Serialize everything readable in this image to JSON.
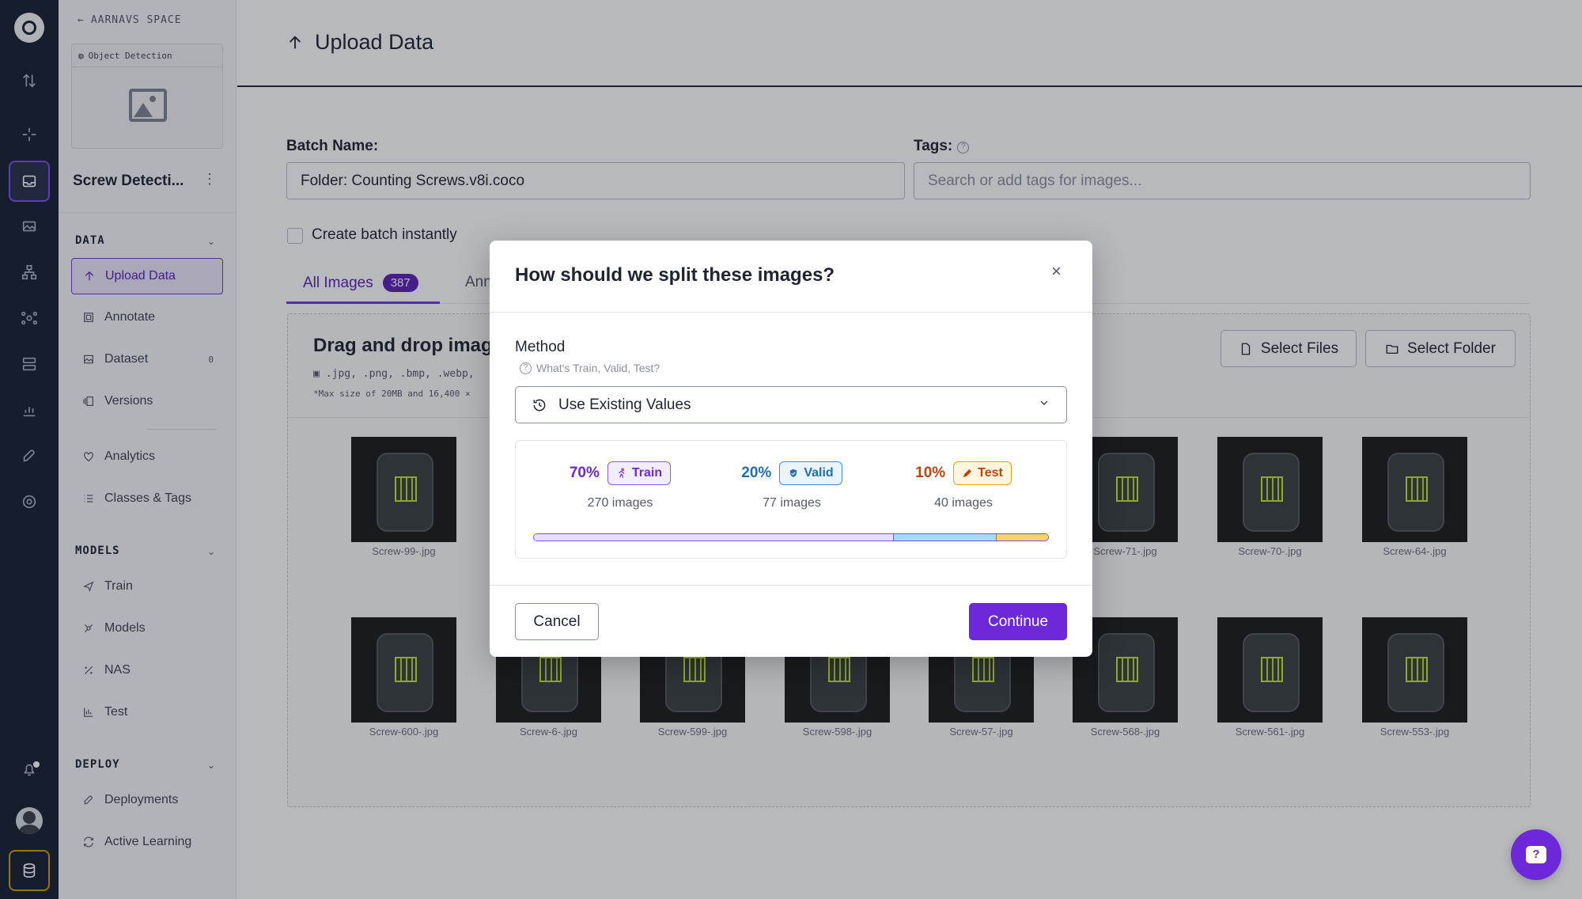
{
  "sidebar": {
    "back_label": "AARNAVS SPACE",
    "project_type": "Object Detection",
    "project_name": "Screw Detecti...",
    "sections": {
      "data": "DATA",
      "models": "MODELS",
      "deploy": "DEPLOY"
    },
    "data_items": [
      {
        "label": "Upload Data",
        "icon": "arrow-up-icon"
      },
      {
        "label": "Annotate",
        "icon": "annotate-icon"
      },
      {
        "label": "Dataset",
        "icon": "image-icon",
        "count": "0"
      },
      {
        "label": "Versions",
        "icon": "versions-icon"
      },
      {
        "label": "Analytics",
        "icon": "heart-pulse-icon"
      },
      {
        "label": "Classes & Tags",
        "icon": "list-icon"
      }
    ],
    "model_items": [
      {
        "label": "Train",
        "icon": "send-icon"
      },
      {
        "label": "Models",
        "icon": "network-icon"
      },
      {
        "label": "NAS",
        "icon": "sparkle-icon"
      },
      {
        "label": "Test",
        "icon": "chart-icon"
      }
    ],
    "deploy_items": [
      {
        "label": "Deployments",
        "icon": "rocket-icon"
      },
      {
        "label": "Active Learning",
        "icon": "refresh-icon"
      }
    ]
  },
  "page": {
    "title": "Upload Data",
    "batch_label": "Batch Name:",
    "batch_value": "Folder: Counting Screws.v8i.coco",
    "tags_label": "Tags:",
    "tags_placeholder": "Search or add tags for images...",
    "create_batch_label": "Create batch instantly",
    "tabs": [
      {
        "label": "All Images",
        "badge": "387"
      },
      {
        "label": "Ann"
      }
    ],
    "drop_title": "Drag and drop imag",
    "drop_formats": ".jpg, .png, .bmp, .webp,",
    "drop_max": "*Max size of 20MB and 16,400 ×",
    "select_files": "Select Files",
    "select_folder": "Select Folder",
    "thumbnails_row1": [
      "Screw-99-.jpg",
      "Screw-71-.jpg",
      "Screw-70-.jpg",
      "Screw-64-.jpg"
    ],
    "thumbnails_row2": [
      "Screw-600-.jpg",
      "Screw-6-.jpg",
      "Screw-599-.jpg",
      "Screw-598-.jpg",
      "Screw-57-.jpg",
      "Screw-568-.jpg",
      "Screw-561-.jpg",
      "Screw-553-.jpg"
    ]
  },
  "modal": {
    "title": "How should we split these images?",
    "method_label": "Method",
    "help_text": "What's Train, Valid, Test?",
    "selected_method": "Use Existing Values",
    "splits": [
      {
        "percent": "70%",
        "label": "Train",
        "count": "270 images",
        "fraction": 0.7,
        "color": "#6d28d9"
      },
      {
        "percent": "20%",
        "label": "Valid",
        "count": "77 images",
        "fraction": 0.2,
        "color": "#1d6fb8"
      },
      {
        "percent": "10%",
        "label": "Test",
        "count": "40 images",
        "fraction": 0.1,
        "color": "#c2410c"
      }
    ],
    "cancel_label": "Cancel",
    "continue_label": "Continue"
  },
  "colors": {
    "accent": "#6d28d9",
    "rail_bg": "#172033"
  }
}
